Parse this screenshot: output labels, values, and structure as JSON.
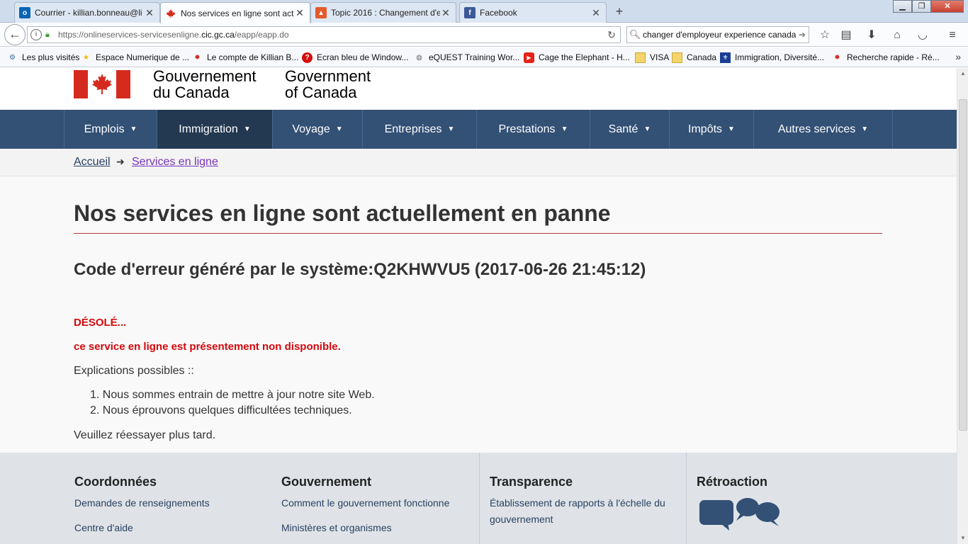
{
  "browser": {
    "tabs": [
      {
        "title": "Courrier - killian.bonneau@li",
        "icon": "outlook-icon",
        "active": false
      },
      {
        "title": "Nos services en ligne sont act",
        "icon": "maple-leaf-icon",
        "active": true
      },
      {
        "title": "Topic 2016 : Changement d'e",
        "icon": "site-icon",
        "active": false
      },
      {
        "title": "Facebook",
        "icon": "facebook-icon",
        "active": false
      }
    ],
    "new_tab": "+",
    "url_prefix": "https://onlineservices-servicesenligne.",
    "url_domain": "cic.gc.ca",
    "url_path": "/eapp/eapp.do",
    "search_value": "changer d'employeur experience canada",
    "bookmarks": [
      {
        "label": "Les plus visités",
        "icon": "gear-icon"
      },
      {
        "label": "Espace Numerique de ...",
        "icon": "star-icon"
      },
      {
        "label": "Le compte de Killian B...",
        "icon": "maple-leaf-icon"
      },
      {
        "label": "Ecran bleu de Window...",
        "icon": "help-icon"
      },
      {
        "label": "eQUEST Training Wor...",
        "icon": "globe-icon"
      },
      {
        "label": "Cage the Elephant - H...",
        "icon": "youtube-icon"
      },
      {
        "label": "VISA",
        "icon": "folder-icon"
      },
      {
        "label": "Canada",
        "icon": "folder-icon"
      },
      {
        "label": "Immigration, Diversité...",
        "icon": "quebec-icon"
      },
      {
        "label": "Recherche rapide - Ré...",
        "icon": "maple-leaf-icon"
      }
    ],
    "bookmarks_more": "»"
  },
  "header": {
    "fr_line1": "Gouvernement",
    "fr_line2": "du Canada",
    "en_line1": "Government",
    "en_line2": "of Canada"
  },
  "menu": [
    {
      "label": "Emplois"
    },
    {
      "label": "Immigration"
    },
    {
      "label": "Voyage"
    },
    {
      "label": "Entreprises"
    },
    {
      "label": "Prestations"
    },
    {
      "label": "Santé"
    },
    {
      "label": "Impôts"
    },
    {
      "label": "Autres services"
    }
  ],
  "breadcrumb": {
    "home": "Accueil",
    "arrow": "➜",
    "current": "Services en ligne"
  },
  "main": {
    "title": "Nos services en ligne sont actuellement en panne",
    "error_code": "Code d'erreur généré par le système:Q2KHWVU5 (2017-06-26 21:45:12)",
    "sorry": "DÉSOLÉ...",
    "unavailable": "ce service en ligne est présentement non disponible.",
    "explanations": "Explications possibles ::",
    "reasons": [
      "1. Nous sommes entrain de mettre à jour notre site Web.",
      "2. Nous éprouvons quelques difficultées techniques."
    ],
    "retry": "Veuillez réessayer plus tard."
  },
  "footer": {
    "cols": [
      {
        "heading": "Coordonnées",
        "links": [
          "Demandes de renseignements",
          "Centre d'aide"
        ]
      },
      {
        "heading": "Gouvernement",
        "links": [
          "Comment le gouvernement fonctionne",
          "Ministères et organismes"
        ]
      },
      {
        "heading": "Transparence",
        "links": [
          "Établissement de rapports à l'échelle du",
          "gouvernement"
        ]
      },
      {
        "heading": "Rétroaction",
        "links": []
      }
    ]
  },
  "colors": {
    "menu_bg": "#335075",
    "accent_red": "#af3c43",
    "alert_red": "#d3080c",
    "visited_link": "#7834bc"
  }
}
